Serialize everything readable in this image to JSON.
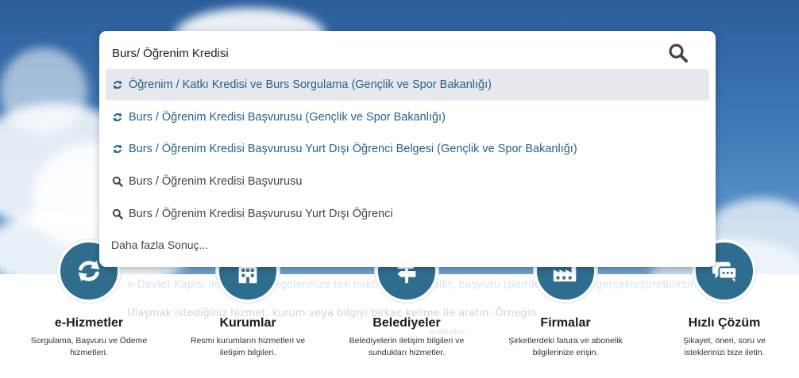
{
  "search": {
    "value": "Burs/ Öğrenim Kredisi",
    "results": [
      {
        "label": "Öğrenim / Katkı Kredisi ve Burs Sorgulama (Gençlik ve Spor Bakanlığı)",
        "icon": "refresh-icon",
        "active": true
      },
      {
        "label": "Burs / Öğrenim Kredisi Başvurusu (Gençlik ve Spor Bakanlığı)",
        "icon": "refresh-icon",
        "active": false
      },
      {
        "label": "Burs / Öğrenim Kredisi Başvurusu Yurt Dışı Öğrenci Belgesi (Gençlik ve Spor Bakanlığı)",
        "icon": "refresh-icon",
        "active": false
      },
      {
        "label": "Burs / Öğrenim Kredisi Başvurusu",
        "icon": "search-icon",
        "active": false
      },
      {
        "label": "Burs / Öğrenim Kredisi Başvurusu Yurt Dışı Öğrenci",
        "icon": "search-icon",
        "active": false
      }
    ],
    "more_label": "Daha fazla Sonuç..."
  },
  "background_text": {
    "line1": "e-Devlet Kapısı ile bilgi ve belgelerinize tek noktadan ulaşabilir, başvuru işlemlerinizi hızla gerçekleştirebilirsiniz.",
    "line2": "Ulaşmak istediğiniz hizmet, kurum veya bilgiyi birkaç kelime ile aratın. Örneğin",
    "line3": "arabalar..."
  },
  "services": [
    {
      "title": "e-Hizmetler",
      "desc": "Sorgulama, Başvuru ve Ödeme hizmetleri.",
      "icon": "refresh-icon"
    },
    {
      "title": "Kurumlar",
      "desc": "Resmi kurumların hizmetleri ve iletişim bilgileri.",
      "icon": "building-icon"
    },
    {
      "title": "Belediyeler",
      "desc": "Belediyelerin iletişim bilgileri ve sundukları hizmetler.",
      "icon": "signpost-icon"
    },
    {
      "title": "Firmalar",
      "desc": "Şirketlerdeki fatura ve abonelik bilgilerinize erişin.",
      "icon": "factory-icon"
    },
    {
      "title": "Hızlı Çözüm",
      "desc": "Şikayet, öneri, soru ve isteklerinizi bize iletin.",
      "icon": "chat-icon"
    }
  ],
  "colors": {
    "accent": "#2f6d8f",
    "link": "#2c5f86",
    "active_row": "#e5e9ed"
  }
}
